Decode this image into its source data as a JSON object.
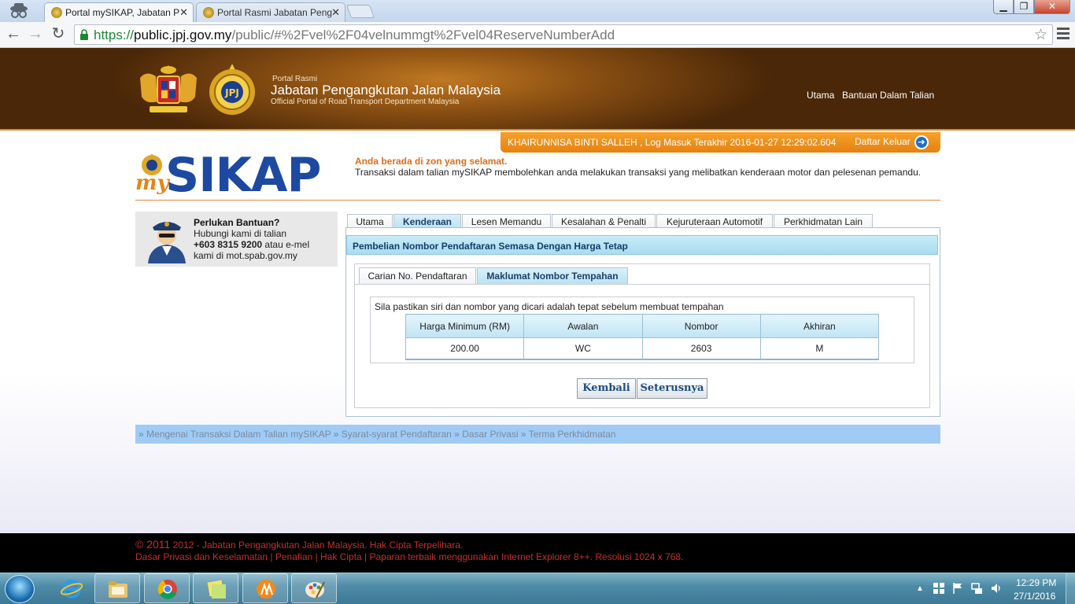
{
  "browser": {
    "tabs": [
      {
        "title": "Portal mySIKAP, Jabatan P",
        "active": true
      },
      {
        "title": "Portal Rasmi Jabatan Peng",
        "active": false
      }
    ],
    "url": {
      "scheme": "https://",
      "host": "public.jpj.gov.my",
      "path": "/public/#%2Fvel%2F04velnummgt%2Fvel04ReserveNumberAdd"
    },
    "close_glyph": "✕",
    "min_glyph": "▁",
    "max_glyph": "❐",
    "back_glyph": "←",
    "forward_glyph": "→",
    "reload_glyph": "↻",
    "star_glyph": "☆"
  },
  "header": {
    "small": "Portal Rasmi",
    "title": "Jabatan Pengangkutan Jalan Malaysia",
    "subtitle": "Official Portal of Road Transport Department Malaysia",
    "links": [
      "Utama",
      "Bantuan Dalam Talian"
    ]
  },
  "user": {
    "info": "KHAIRUNNISA BINTI SALLEH , Log Masuk Terakhir 2016-01-27 12:29:02.604",
    "logout": "Daftar Keluar",
    "logout_glyph": "➔"
  },
  "logo": {
    "my": "my",
    "sikap": "SIKAP"
  },
  "notice": {
    "title": "Anda berada di zon yang selamat.",
    "text": "Transaksi dalam talian mySIKAP membolehkan anda melakukan transaksi yang melibatkan kenderaan motor dan pelesenan pemandu."
  },
  "help": {
    "title": "Perlukan Bantuan?",
    "line1": "Hubungi kami di talian",
    "phone": "+603 8315 9200",
    "line2_suffix": " atau e-mel",
    "line3": "kami di mot.spab.gov.my"
  },
  "main_tabs": [
    "Utama",
    "Kenderaan",
    "Lesen Memandu",
    "Kesalahan & Penalti",
    "Kejuruteraan Automotif",
    "Perkhidmatan Lain"
  ],
  "panel": {
    "title": "Pembelian Nombor Pendaftaran Semasa Dengan Harga Tetap",
    "sub_tabs": [
      "Carian No. Pendaftaran",
      "Maklumat Nombor Tempahan"
    ],
    "confirm_text": "Sila pastikan siri dan nombor yang dicari adalah tepat sebelum membuat tempahan",
    "table": {
      "headers": [
        "Harga Minimum (RM)",
        "Awalan",
        "Nombor",
        "Akhiran"
      ],
      "row": [
        "200.00",
        "WC",
        "2603",
        "M"
      ]
    },
    "buttons": {
      "back": "Kembali",
      "next": "Seterusnya"
    }
  },
  "footer_links": [
    "Mengenai Transaksi Dalam Talian mySIKAP",
    "Syarat-syarat Pendaftaran",
    "Dasar Privasi",
    "Terma Perkhidmatan"
  ],
  "footer_sep": "»",
  "copyright": {
    "year": "© 2011",
    "text": " 2012 - Jabatan Pengangkutan Jalan Malaysia. Hak Cipta Terpelihara.",
    "line2": "Dasar Privasi dan Keselamatan | Penafian | Hak Cipta | Paparan terbaik menggunakan Internet Explorer 8++. Resolusi 1024 x 768."
  },
  "taskbar": {
    "time": "12:29 PM",
    "date": "27/1/2016",
    "tray_arrow": "▲"
  },
  "colors": {
    "accent_orange": "#e58212",
    "header_brown": "#8a4f12",
    "tab_blue": "#b9e1f3",
    "link_bar": "#9fcbf5",
    "footer_red": "#c4302a"
  }
}
